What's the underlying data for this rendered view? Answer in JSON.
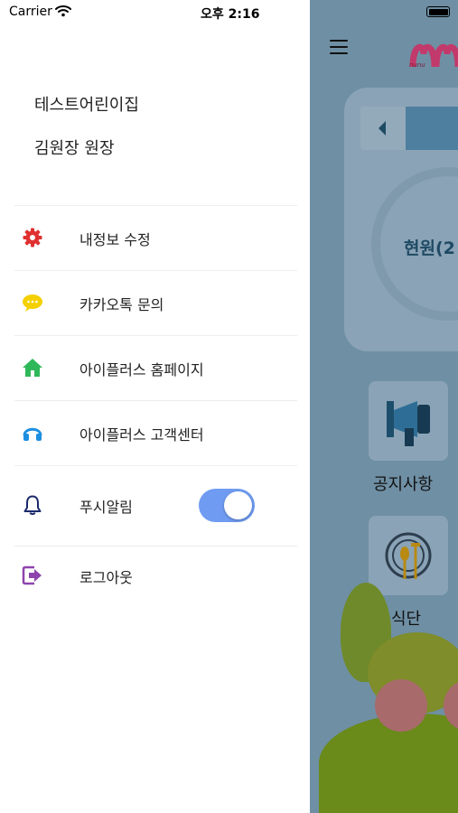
{
  "status_bar": {
    "carrier": "Carrier",
    "time": "오후 2:16"
  },
  "drawer": {
    "daycare_name": "테스트어린이집",
    "user_name": "김원장 원장",
    "menu": [
      {
        "label": "내정보 수정",
        "icon": "gear-icon",
        "color": "#e03131"
      },
      {
        "label": "카카오톡 문의",
        "icon": "chat-bubble-icon",
        "color": "#f4d000"
      },
      {
        "label": "아이플러스 홈페이지",
        "icon": "home-icon",
        "color": "#2fb85a"
      },
      {
        "label": "아이플러스 고객센터",
        "icon": "headset-icon",
        "color": "#1d8fe0"
      },
      {
        "label": "푸시알림",
        "icon": "bell-icon",
        "color": "#1c2a6b"
      },
      {
        "label": "로그아웃",
        "icon": "logout-icon",
        "color": "#8e44ad"
      }
    ],
    "push_toggle_on": true
  },
  "background": {
    "logo_text": "nunu",
    "current_label": "현원(2",
    "tiles": [
      {
        "label": "공지사항",
        "icon": "megaphone-icon"
      },
      {
        "label": "식단",
        "icon": "plate-icon"
      }
    ]
  }
}
